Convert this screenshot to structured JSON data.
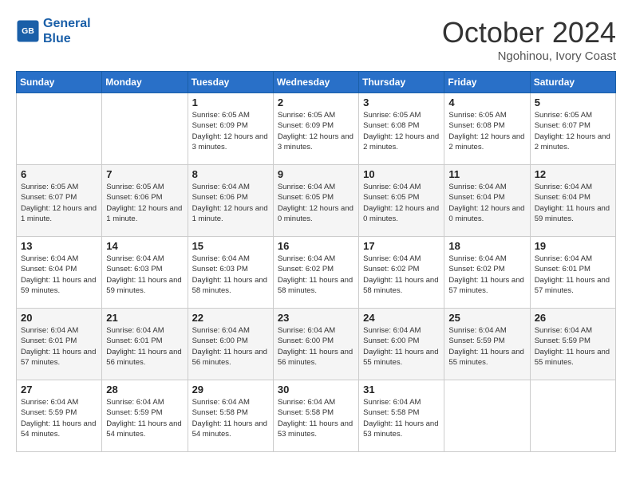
{
  "header": {
    "logo_line1": "General",
    "logo_line2": "Blue",
    "month": "October 2024",
    "location": "Ngohinou, Ivory Coast"
  },
  "days_of_week": [
    "Sunday",
    "Monday",
    "Tuesday",
    "Wednesday",
    "Thursday",
    "Friday",
    "Saturday"
  ],
  "weeks": [
    [
      {
        "day": "",
        "info": ""
      },
      {
        "day": "",
        "info": ""
      },
      {
        "day": "1",
        "info": "Sunrise: 6:05 AM\nSunset: 6:09 PM\nDaylight: 12 hours and 3 minutes."
      },
      {
        "day": "2",
        "info": "Sunrise: 6:05 AM\nSunset: 6:09 PM\nDaylight: 12 hours and 3 minutes."
      },
      {
        "day": "3",
        "info": "Sunrise: 6:05 AM\nSunset: 6:08 PM\nDaylight: 12 hours and 2 minutes."
      },
      {
        "day": "4",
        "info": "Sunrise: 6:05 AM\nSunset: 6:08 PM\nDaylight: 12 hours and 2 minutes."
      },
      {
        "day": "5",
        "info": "Sunrise: 6:05 AM\nSunset: 6:07 PM\nDaylight: 12 hours and 2 minutes."
      }
    ],
    [
      {
        "day": "6",
        "info": "Sunrise: 6:05 AM\nSunset: 6:07 PM\nDaylight: 12 hours and 1 minute."
      },
      {
        "day": "7",
        "info": "Sunrise: 6:05 AM\nSunset: 6:06 PM\nDaylight: 12 hours and 1 minute."
      },
      {
        "day": "8",
        "info": "Sunrise: 6:04 AM\nSunset: 6:06 PM\nDaylight: 12 hours and 1 minute."
      },
      {
        "day": "9",
        "info": "Sunrise: 6:04 AM\nSunset: 6:05 PM\nDaylight: 12 hours and 0 minutes."
      },
      {
        "day": "10",
        "info": "Sunrise: 6:04 AM\nSunset: 6:05 PM\nDaylight: 12 hours and 0 minutes."
      },
      {
        "day": "11",
        "info": "Sunrise: 6:04 AM\nSunset: 6:04 PM\nDaylight: 12 hours and 0 minutes."
      },
      {
        "day": "12",
        "info": "Sunrise: 6:04 AM\nSunset: 6:04 PM\nDaylight: 11 hours and 59 minutes."
      }
    ],
    [
      {
        "day": "13",
        "info": "Sunrise: 6:04 AM\nSunset: 6:04 PM\nDaylight: 11 hours and 59 minutes."
      },
      {
        "day": "14",
        "info": "Sunrise: 6:04 AM\nSunset: 6:03 PM\nDaylight: 11 hours and 59 minutes."
      },
      {
        "day": "15",
        "info": "Sunrise: 6:04 AM\nSunset: 6:03 PM\nDaylight: 11 hours and 58 minutes."
      },
      {
        "day": "16",
        "info": "Sunrise: 6:04 AM\nSunset: 6:02 PM\nDaylight: 11 hours and 58 minutes."
      },
      {
        "day": "17",
        "info": "Sunrise: 6:04 AM\nSunset: 6:02 PM\nDaylight: 11 hours and 58 minutes."
      },
      {
        "day": "18",
        "info": "Sunrise: 6:04 AM\nSunset: 6:02 PM\nDaylight: 11 hours and 57 minutes."
      },
      {
        "day": "19",
        "info": "Sunrise: 6:04 AM\nSunset: 6:01 PM\nDaylight: 11 hours and 57 minutes."
      }
    ],
    [
      {
        "day": "20",
        "info": "Sunrise: 6:04 AM\nSunset: 6:01 PM\nDaylight: 11 hours and 57 minutes."
      },
      {
        "day": "21",
        "info": "Sunrise: 6:04 AM\nSunset: 6:01 PM\nDaylight: 11 hours and 56 minutes."
      },
      {
        "day": "22",
        "info": "Sunrise: 6:04 AM\nSunset: 6:00 PM\nDaylight: 11 hours and 56 minutes."
      },
      {
        "day": "23",
        "info": "Sunrise: 6:04 AM\nSunset: 6:00 PM\nDaylight: 11 hours and 56 minutes."
      },
      {
        "day": "24",
        "info": "Sunrise: 6:04 AM\nSunset: 6:00 PM\nDaylight: 11 hours and 55 minutes."
      },
      {
        "day": "25",
        "info": "Sunrise: 6:04 AM\nSunset: 5:59 PM\nDaylight: 11 hours and 55 minutes."
      },
      {
        "day": "26",
        "info": "Sunrise: 6:04 AM\nSunset: 5:59 PM\nDaylight: 11 hours and 55 minutes."
      }
    ],
    [
      {
        "day": "27",
        "info": "Sunrise: 6:04 AM\nSunset: 5:59 PM\nDaylight: 11 hours and 54 minutes."
      },
      {
        "day": "28",
        "info": "Sunrise: 6:04 AM\nSunset: 5:59 PM\nDaylight: 11 hours and 54 minutes."
      },
      {
        "day": "29",
        "info": "Sunrise: 6:04 AM\nSunset: 5:58 PM\nDaylight: 11 hours and 54 minutes."
      },
      {
        "day": "30",
        "info": "Sunrise: 6:04 AM\nSunset: 5:58 PM\nDaylight: 11 hours and 53 minutes."
      },
      {
        "day": "31",
        "info": "Sunrise: 6:04 AM\nSunset: 5:58 PM\nDaylight: 11 hours and 53 minutes."
      },
      {
        "day": "",
        "info": ""
      },
      {
        "day": "",
        "info": ""
      }
    ]
  ]
}
